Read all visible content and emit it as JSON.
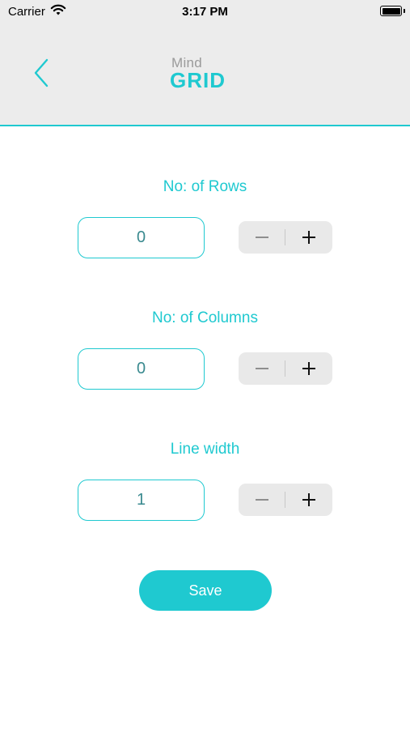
{
  "status_bar": {
    "carrier": "Carrier",
    "time": "3:17 PM"
  },
  "header": {
    "logo_top": "Mind",
    "logo_bottom": "GRID"
  },
  "rows": {
    "label": "No: of Rows",
    "value": "0"
  },
  "columns": {
    "label": "No: of Columns",
    "value": "0"
  },
  "line_width": {
    "label": "Line width",
    "value": "1"
  },
  "save_label": "Save",
  "colors": {
    "accent": "#1fc9d0",
    "header_bg": "#ececec",
    "stepper_bg": "#e9e9e9",
    "value_text": "#3a8a8f"
  },
  "icons": {
    "back": "chevron-left-icon",
    "minus": "minus-icon",
    "plus": "plus-icon",
    "wifi": "wifi-icon",
    "battery": "battery-icon"
  }
}
